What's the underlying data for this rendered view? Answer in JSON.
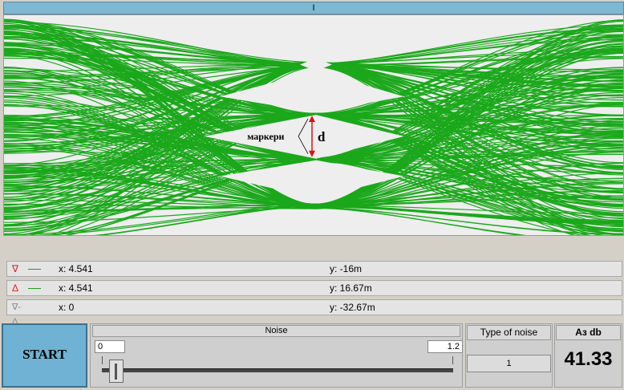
{
  "window": {
    "title": "I"
  },
  "plot": {
    "trace_color": "#1ba81b",
    "annotation_label": "маркери",
    "annotation_letter": "d",
    "marker_color": "#e01010"
  },
  "markers": [
    {
      "symbol": "∇",
      "symbol_color": "#e02020",
      "x": "x: 4.541",
      "y": "y: -16m"
    },
    {
      "symbol": "Δ",
      "symbol_color": "#e02020",
      "x": "x: 4.541",
      "y": "y: 16.67m"
    },
    {
      "symbol": "∇-Δ",
      "symbol_color": "#888888",
      "x": "x: 0",
      "y": "y: -32.67m"
    }
  ],
  "controls": {
    "start_label": "START",
    "noise": {
      "title": "Noise",
      "min": "0",
      "max": "1.2",
      "value": 0.05
    },
    "type_of_noise": {
      "title": "Type of noise",
      "value": "1"
    },
    "az": {
      "title": "Aз  db",
      "value": "41.33"
    }
  }
}
